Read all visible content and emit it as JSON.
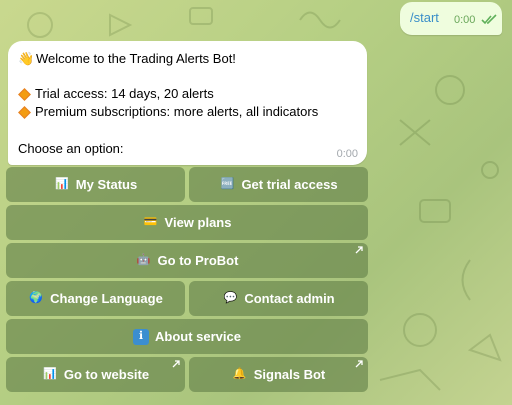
{
  "outgoing": {
    "text": "/start",
    "time": "0:00",
    "status_icon": "double-check-icon"
  },
  "incoming": {
    "greeting_emoji": "👋",
    "greeting": "Welcome to the Trading Alerts Bot!",
    "bullets": [
      "Trial access: 14 days, 20 alerts",
      "Premium subscriptions: more alerts, all indicators"
    ],
    "prompt": "Choose an option:",
    "time": "0:00"
  },
  "keyboard": [
    {
      "label": "My Status",
      "icon": "bar-chart-icon",
      "glyph": "📊"
    },
    {
      "label": "Get trial access",
      "icon": "free-badge-icon",
      "glyph": "🆓"
    },
    {
      "label": "View plans",
      "icon": "credit-card-icon",
      "glyph": "💳"
    },
    {
      "label": "Go to ProBot",
      "icon": "robot-icon",
      "glyph": "🤖",
      "external": true
    },
    {
      "label": "Change Language",
      "icon": "globe-icon",
      "glyph": "🌍"
    },
    {
      "label": "Contact admin",
      "icon": "speech-bubble-icon",
      "glyph": "💬"
    },
    {
      "label": "About service",
      "icon": "info-icon",
      "glyph": "ℹ"
    },
    {
      "label": "Go to website",
      "icon": "bar-chart-icon",
      "glyph": "📊",
      "external": true
    },
    {
      "label": "Signals Bot",
      "icon": "bell-icon",
      "glyph": "🔔",
      "external": true
    }
  ],
  "colors": {
    "background": "#b6cf84",
    "outgoing_bubble": "#effdde",
    "incoming_bubble": "#ffffff",
    "button": "#628048",
    "link": "#3a8fc9",
    "bullet": "#f39c12"
  }
}
